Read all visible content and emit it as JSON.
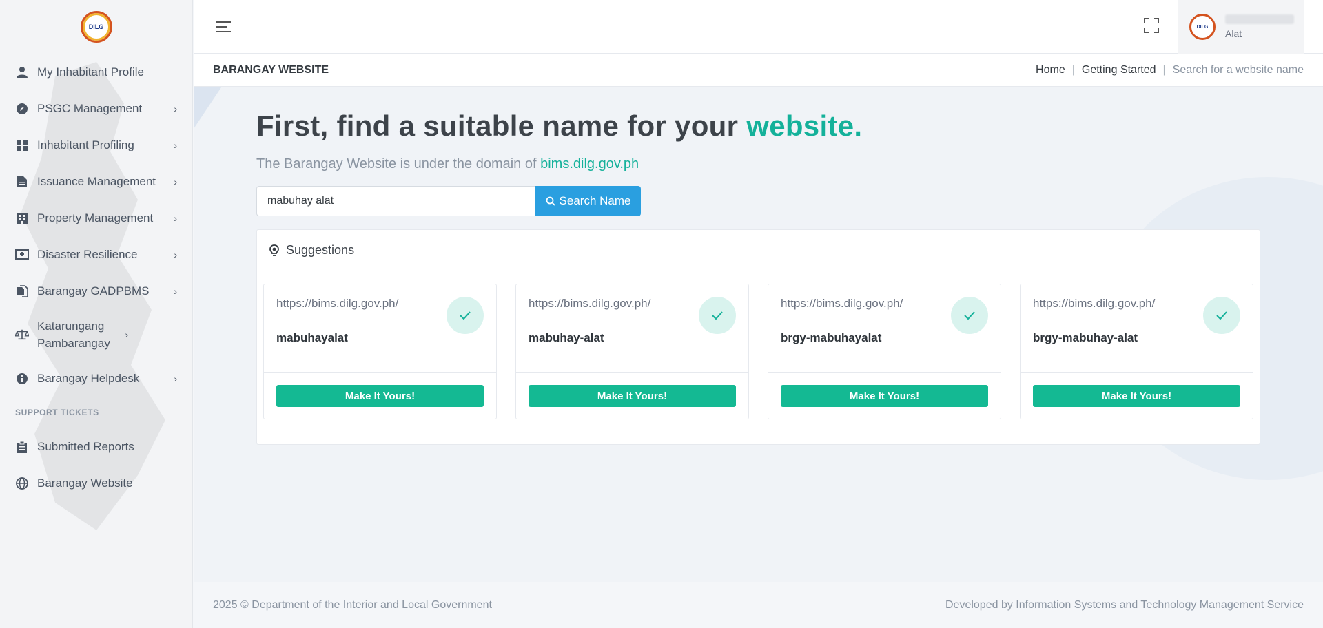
{
  "brand": {
    "logo_text": "DILG"
  },
  "sidebar": {
    "items": [
      {
        "label": "My Inhabitant Profile",
        "icon": "user-icon",
        "has_children": false
      },
      {
        "label": "PSGC Management",
        "icon": "compass-icon",
        "has_children": true
      },
      {
        "label": "Inhabitant Profiling",
        "icon": "grid-icon",
        "has_children": true
      },
      {
        "label": "Issuance Management",
        "icon": "document-icon",
        "has_children": true
      },
      {
        "label": "Property Management",
        "icon": "building-icon",
        "has_children": true
      },
      {
        "label": "Disaster Resilience",
        "icon": "monitor-plus-icon",
        "has_children": true
      },
      {
        "label": "Barangay GADPBMS",
        "icon": "copy-icon",
        "has_children": true
      },
      {
        "label": "Katarungang Pambarangay",
        "icon": "scale-icon",
        "has_children": true
      },
      {
        "label": "Barangay Helpdesk",
        "icon": "info-icon",
        "has_children": true
      }
    ],
    "section_label": "SUPPORT TICKETS",
    "support_items": [
      {
        "label": "Submitted Reports",
        "icon": "clipboard-icon"
      },
      {
        "label": "Barangay Website",
        "icon": "globe-icon"
      }
    ]
  },
  "topbar": {
    "user_sub": "Alat",
    "avatar_text": "DILG"
  },
  "subheader": {
    "title": "BARANGAY WEBSITE",
    "breadcrumb": [
      "Home",
      "Getting Started",
      "Search for a website name"
    ]
  },
  "hero": {
    "title_main": "First, find a suitable name for your ",
    "title_accent": "website.",
    "subtitle_text": "The Barangay Website is under the domain of ",
    "subtitle_domain": "bims.dilg.gov.ph"
  },
  "search": {
    "value": "mabuhay alat",
    "button_label": "Search Name"
  },
  "suggestions": {
    "title": "Suggestions",
    "cards": [
      {
        "url": "https://bims.dilg.gov.ph/",
        "name": "mabuhayalat",
        "button": "Make It Yours!"
      },
      {
        "url": "https://bims.dilg.gov.ph/",
        "name": "mabuhay-alat",
        "button": "Make It Yours!"
      },
      {
        "url": "https://bims.dilg.gov.ph/",
        "name": "brgy-mabuhayalat",
        "button": "Make It Yours!"
      },
      {
        "url": "https://bims.dilg.gov.ph/",
        "name": "brgy-mabuhay-alat",
        "button": "Make It Yours!"
      }
    ]
  },
  "footer": {
    "left": "2025 © Department of the Interior and Local Government",
    "right": "Developed by Information Systems and Technology Management Service"
  },
  "colors": {
    "accent": "#14b19a",
    "button_primary": "#2a9fe0",
    "button_success": "#14b993"
  }
}
